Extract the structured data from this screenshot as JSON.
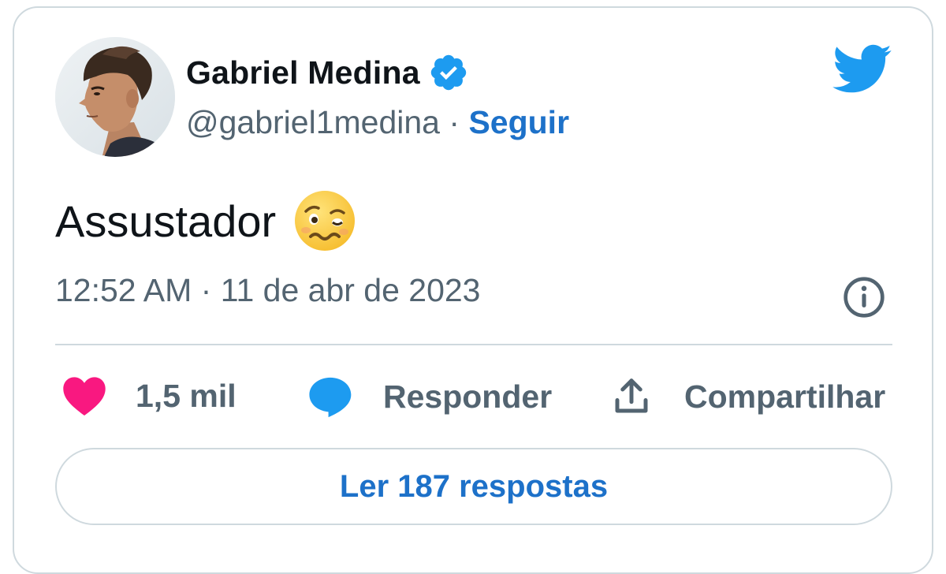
{
  "tweet": {
    "author": {
      "name": "Gabriel Medina",
      "handle": "@gabriel1medina",
      "separator": "·",
      "follow_label": "Seguir",
      "verified": true
    },
    "text": "Assustador",
    "emoji": "woozy-face",
    "time": "12:52 AM",
    "date": "11 de abr de 2023",
    "actions": {
      "likes": "1,5 mil",
      "reply_label": "Responder",
      "share_label": "Compartilhar"
    },
    "read_replies_label": "Ler 187 respostas"
  },
  "colors": {
    "twitter_blue": "#1d9bf0",
    "link_blue": "#1d71c9",
    "heart_pink": "#f91880",
    "muted_text": "#536471",
    "border": "#cfd9de"
  },
  "icons": [
    "twitter-bird-icon",
    "verified-badge-icon",
    "info-icon",
    "heart-icon",
    "reply-bubble-icon",
    "share-icon"
  ]
}
